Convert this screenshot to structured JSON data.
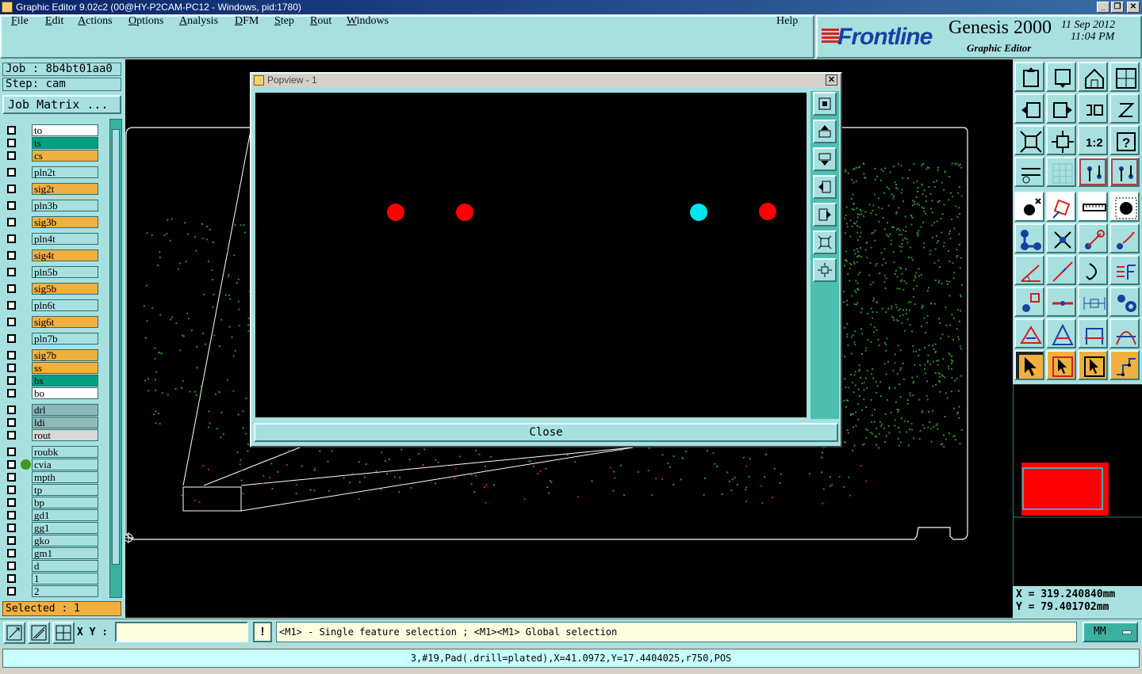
{
  "window": {
    "title": "Graphic Editor 9.02c2 (00@HY-P2CAM-PC12 - Windows, pid:1780)"
  },
  "menu": {
    "items": [
      {
        "label": "File",
        "ul": "F",
        "rest": "ile"
      },
      {
        "label": "Edit",
        "ul": "E",
        "rest": "dit"
      },
      {
        "label": "Actions",
        "ul": "A",
        "rest": "ctions"
      },
      {
        "label": "Options",
        "ul": "O",
        "rest": "ptions"
      },
      {
        "label": "Analysis",
        "ul": "A",
        "rest": "nalysis"
      },
      {
        "label": "DFM",
        "ul": "D",
        "rest": "FM"
      },
      {
        "label": "Step",
        "ul": "S",
        "rest": "tep"
      },
      {
        "label": "Rout",
        "ul": "R",
        "rest": "out"
      },
      {
        "label": "Windows",
        "ul": "W",
        "rest": "indows"
      }
    ],
    "help": "Help"
  },
  "brand": {
    "logo": "Frontline",
    "product": "Genesis 2000",
    "subtitle": "Graphic Editor",
    "date": "11 Sep 2012",
    "time": "11:04 PM"
  },
  "job": {
    "job_line": "Job : 8b4bt01aa0",
    "step_line": "Step: cam",
    "matrix_button": "Job Matrix ..."
  },
  "layers": [
    {
      "name": "to",
      "color": "#ffffff"
    },
    {
      "name": "ts",
      "color": "#00a080"
    },
    {
      "name": "cs",
      "color": "#f0b040"
    },
    {
      "name": "pln2t",
      "color": "#a8e0e0"
    },
    {
      "name": "sig2t",
      "color": "#f0b040"
    },
    {
      "name": "pln3b",
      "color": "#a8e0e0"
    },
    {
      "name": "sig3b",
      "color": "#f0b040"
    },
    {
      "name": "pln4t",
      "color": "#a8e0e0"
    },
    {
      "name": "sig4t",
      "color": "#f0b040"
    },
    {
      "name": "pln5b",
      "color": "#a8e0e0"
    },
    {
      "name": "sig5b",
      "color": "#f0b040"
    },
    {
      "name": "pln6t",
      "color": "#a8e0e0"
    },
    {
      "name": "sig6t",
      "color": "#f0b040"
    },
    {
      "name": "pln7b",
      "color": "#a8e0e0"
    },
    {
      "name": "sig7b",
      "color": "#f0b040"
    },
    {
      "name": "ss",
      "color": "#f0b040"
    },
    {
      "name": "bs",
      "color": "#00a080"
    },
    {
      "name": "bo",
      "color": "#ffffff"
    },
    {
      "name": "drl",
      "color": "#8fb8b8"
    },
    {
      "name": "ldi",
      "color": "#8fb8b8"
    },
    {
      "name": "rout",
      "color": "#d8d8d8"
    },
    {
      "name": "roubk",
      "color": "#a8e0e0"
    },
    {
      "name": "cvia",
      "color": "#a8e0e0",
      "active": true
    },
    {
      "name": "mpth",
      "color": "#a8e0e0"
    },
    {
      "name": "tp",
      "color": "#a8e0e0"
    },
    {
      "name": "bp",
      "color": "#a8e0e0"
    },
    {
      "name": "gd1",
      "color": "#a8e0e0"
    },
    {
      "name": "gg1",
      "color": "#a8e0e0"
    },
    {
      "name": "gko",
      "color": "#a8e0e0"
    },
    {
      "name": "gm1",
      "color": "#a8e0e0"
    },
    {
      "name": "d",
      "color": "#a8e0e0"
    },
    {
      "name": "1",
      "color": "#a8e0e0"
    },
    {
      "name": "2",
      "color": "#a8e0e0"
    }
  ],
  "selected": "Selected : 1",
  "popview": {
    "title": "Popview - 1",
    "close_label": "Close"
  },
  "coords": {
    "x": "X = 319.240840mm",
    "y": "Y = 79.401702mm"
  },
  "bottom": {
    "xy_label": "X Y :",
    "xy_value": "",
    "warn": "!",
    "hint": "<M1> - Single feature selection ; <M1><M1> Global selection",
    "units": "MM",
    "status": "3,#19,Pad(.drill=plated),X=41.0972,Y=17.4404025,r750,POS"
  },
  "colors": {
    "panel": "#a8e0e0",
    "accent": "#3cb0a0",
    "pad_red": "#ff0000",
    "pad_cyan": "#00e5ee",
    "board_outline": "#ffffff",
    "dots": "#2e8b2e"
  },
  "pads": [
    {
      "color": "red"
    },
    {
      "color": "red"
    },
    {
      "color": "cyan"
    },
    {
      "color": "red"
    }
  ]
}
